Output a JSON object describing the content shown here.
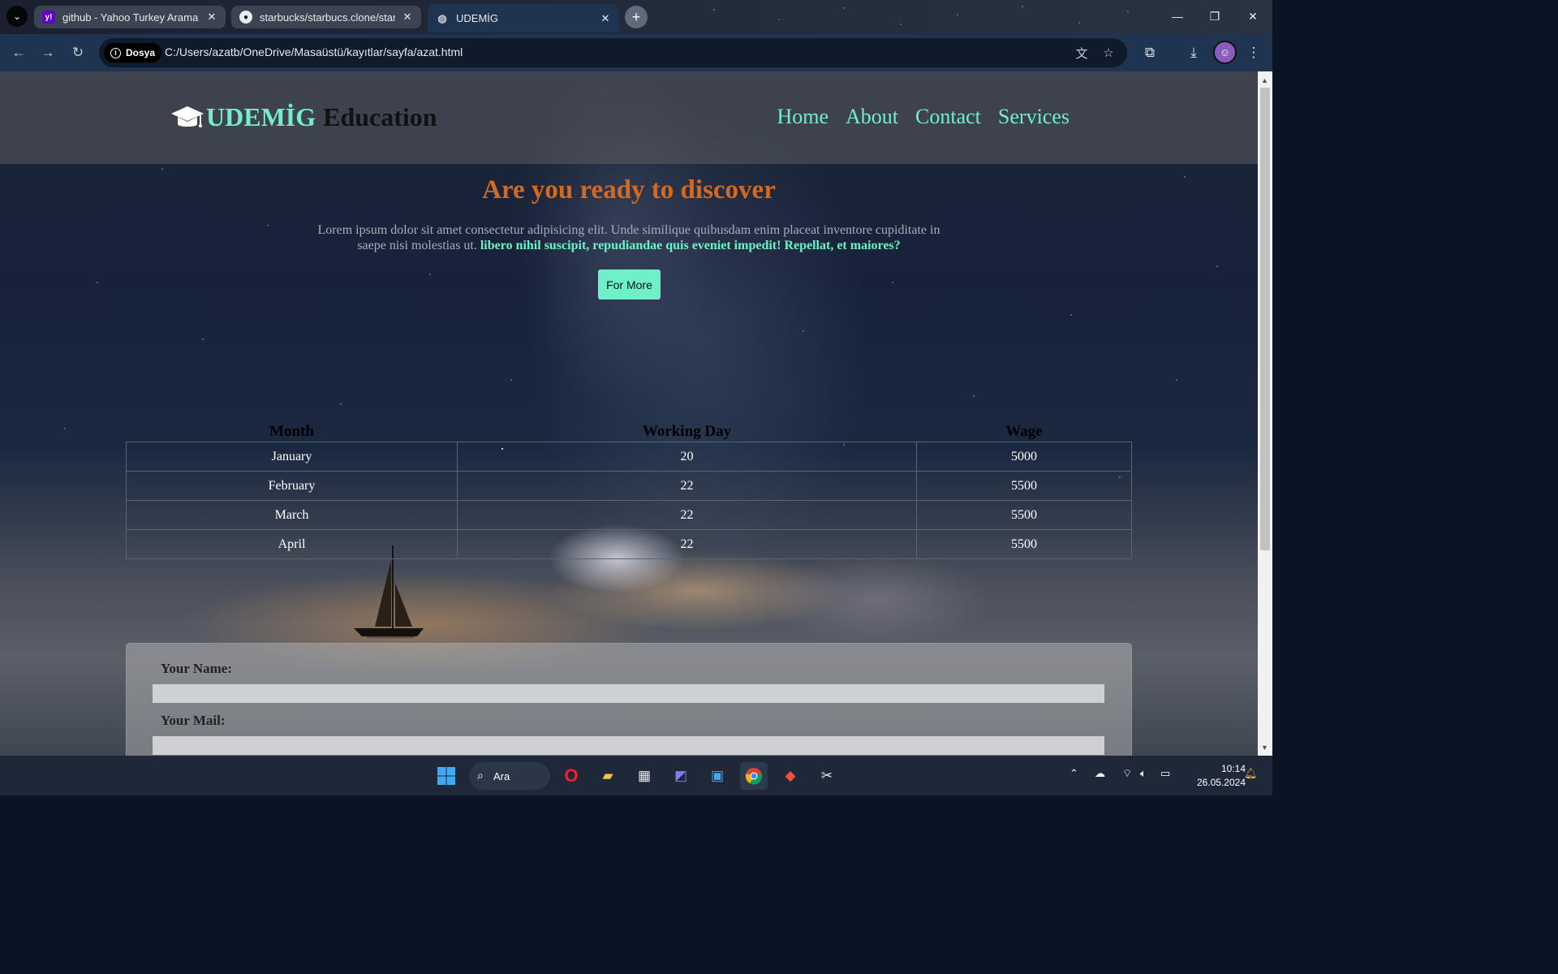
{
  "browser": {
    "tabs": [
      {
        "title": "github - Yahoo Turkey Arama Sonuçları",
        "favicon": "yahoo-icon"
      },
      {
        "title": "starbucks/starbucs.clone/starbucks",
        "favicon": "github-icon"
      },
      {
        "title": "UDEMİG",
        "favicon": "globe-icon"
      }
    ],
    "site_chip": "Dosya",
    "url": "C:/Users/azatb/OneDrive/Masaüstü/kayıtlar/sayfa/azat.html"
  },
  "site": {
    "logo_brand": "UDEMİG",
    "logo_suffix": "Education",
    "nav": [
      "Home",
      "About",
      "Contact",
      "Services"
    ]
  },
  "hero": {
    "title": "Are you ready to discover",
    "text_plain": "Lorem ipsum dolor sit amet consectetur adipisicing elit. Unde similique quibusdam enim placeat inventore cupiditate in saepe nisi molestias ut.",
    "text_bold": "libero nihil suscipit, repudiandae quis eveniet impedit! Repellat, et maiores?",
    "button": "For More"
  },
  "table": {
    "headers": [
      "Month",
      "Working Day",
      "Wage"
    ],
    "rows": [
      [
        "January",
        "20",
        "5000"
      ],
      [
        "February",
        "22",
        "5500"
      ],
      [
        "March",
        "22",
        "5500"
      ],
      [
        "April",
        "22",
        "5500"
      ]
    ]
  },
  "form": {
    "name_label": "Your Name:",
    "mail_label": "Your Mail:"
  },
  "taskbar": {
    "search": "Ara",
    "time": "10:14",
    "date": "26.05.2024"
  },
  "colors": {
    "accent": "#6ff0c8",
    "title": "#d4691f",
    "chrome": "#1f3450"
  }
}
